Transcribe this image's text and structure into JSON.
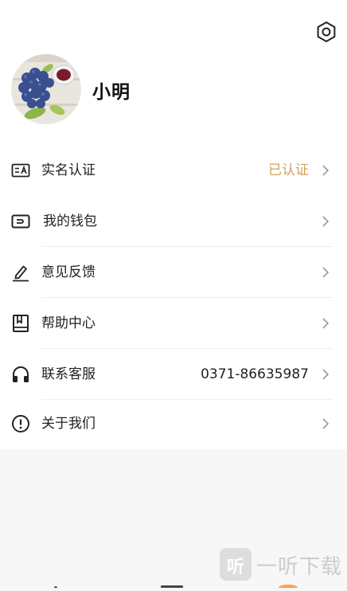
{
  "header": {
    "settings_icon": "gear-icon"
  },
  "profile": {
    "username": "小明",
    "avatar": "avatar-photo"
  },
  "menu": [
    {
      "id": "realname",
      "icon": "id-card-icon",
      "label": "实名认证",
      "value": "已认证",
      "value_color": "#d4a05f"
    },
    {
      "id": "wallet",
      "icon": "wallet-icon",
      "label": "我的钱包",
      "value": ""
    },
    {
      "id": "feedback",
      "icon": "edit-pen-icon",
      "label": "意见反馈",
      "value": ""
    },
    {
      "id": "help",
      "icon": "book-icon",
      "label": "帮助中心",
      "value": ""
    },
    {
      "id": "service",
      "icon": "headphones-icon",
      "label": "联系客服",
      "value": "0371-86635987"
    },
    {
      "id": "about",
      "icon": "info-circle-icon",
      "label": "关于我们",
      "value": ""
    }
  ],
  "watermark": {
    "logo_char": "听",
    "text": "一听下载"
  }
}
